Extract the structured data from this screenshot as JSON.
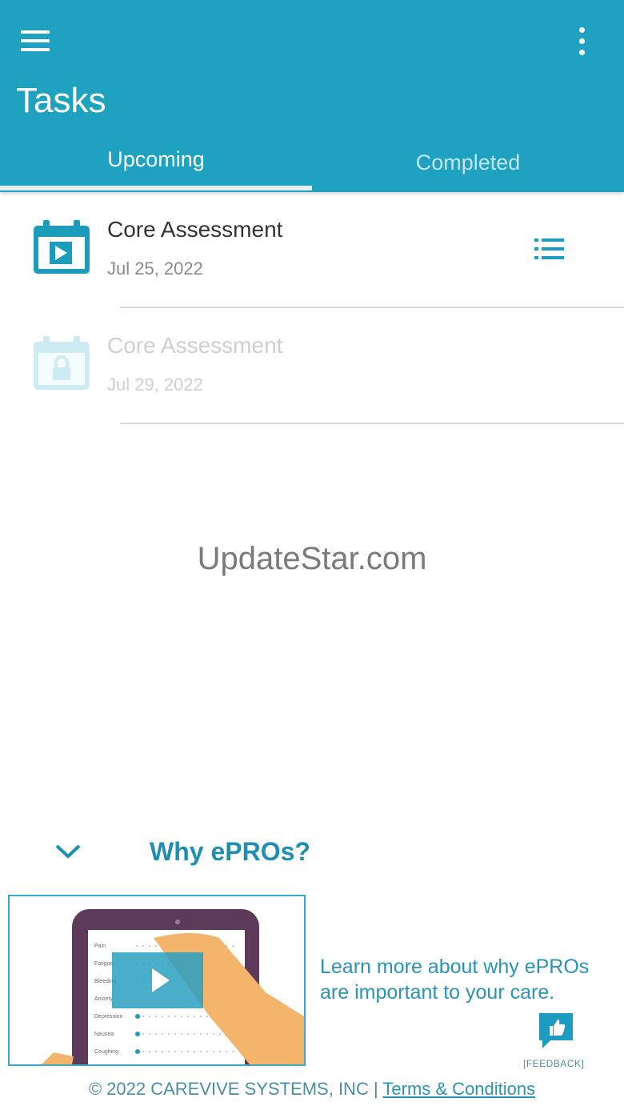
{
  "colors": {
    "header_bg": "#1fa1c0",
    "accent": "#1e8fb0",
    "locked": "#cfeaf1"
  },
  "header": {
    "title": "Tasks",
    "menu_icon": "hamburger-icon",
    "more_icon": "more-vert-icon",
    "tabs": [
      {
        "label": "Upcoming",
        "active": true
      },
      {
        "label": "Completed",
        "active": false
      }
    ]
  },
  "tasks": [
    {
      "name": "Core Assessment",
      "date": "Jul 25, 2022",
      "icon": "calendar-play-icon",
      "locked": false,
      "action_icon": "list-icon"
    },
    {
      "name": "Core Assessment",
      "date": "Jul 29, 2022",
      "icon": "calendar-lock-icon",
      "locked": true
    }
  ],
  "watermark": "UpdateStar.com",
  "why": {
    "title": "Why ePROs?",
    "icon": "chevron-down-icon"
  },
  "video": {
    "icon": "play-icon"
  },
  "learn_text": "Learn more about why ePROs are important to your care.",
  "feedback": {
    "label": "[FEEDBACK]",
    "icon": "thumbs-up-icon"
  },
  "footer": {
    "copyright": "© 2022 CAREVIVE SYSTEMS, INC | ",
    "terms_link": "Terms & Conditions"
  }
}
